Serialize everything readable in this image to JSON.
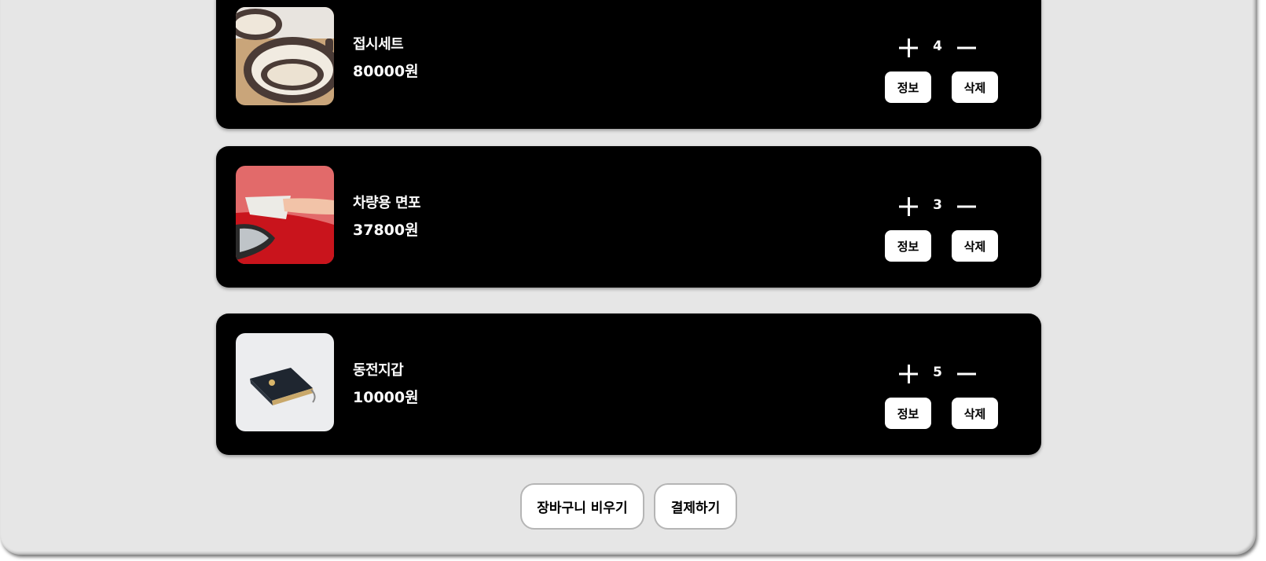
{
  "cart": {
    "items": [
      {
        "name": "접시세트",
        "price": "80000원",
        "quantity": "4",
        "info_label": "정보",
        "delete_label": "삭제",
        "image_icon": "dish-set-image"
      },
      {
        "name": "차량용 면포",
        "price": "37800원",
        "quantity": "3",
        "info_label": "정보",
        "delete_label": "삭제",
        "image_icon": "car-cloth-image"
      },
      {
        "name": "동전지갑",
        "price": "10000원",
        "quantity": "5",
        "info_label": "정보",
        "delete_label": "삭제",
        "image_icon": "coin-wallet-image"
      }
    ],
    "actions": {
      "clear_label": "장바구니 비우기",
      "checkout_label": "결제하기"
    }
  },
  "colors": {
    "page_background": "#e6e6e6",
    "card_background": "#000000",
    "card_text": "#ffffff",
    "button_background": "#ffffff",
    "button_text": "#000000"
  }
}
